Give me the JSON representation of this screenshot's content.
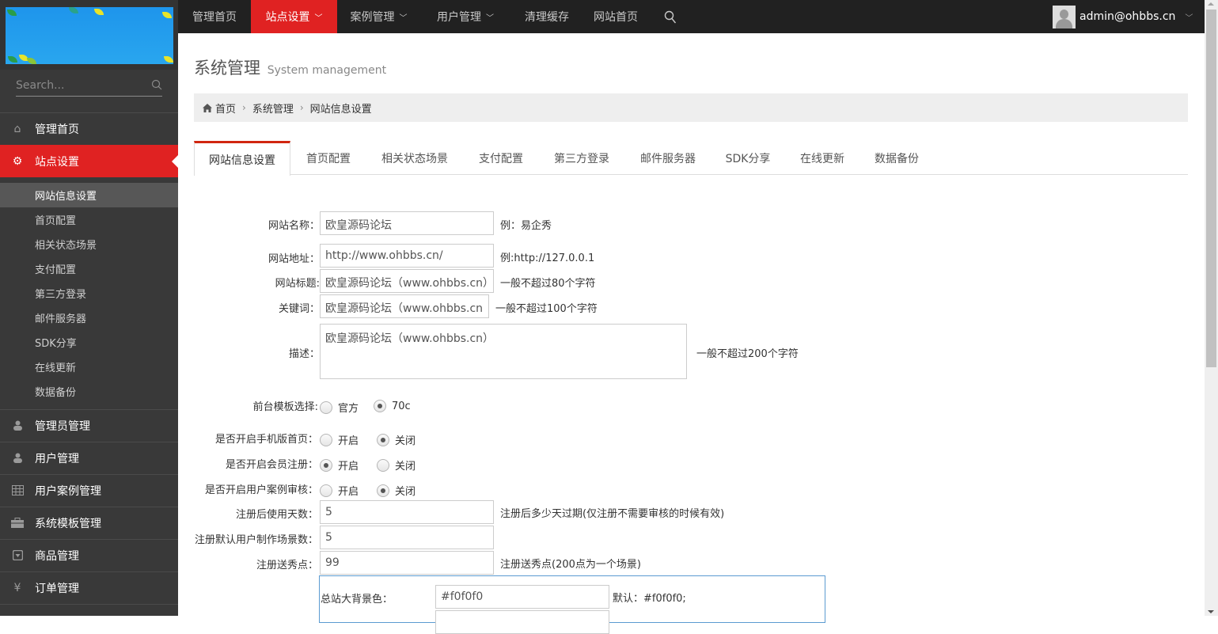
{
  "sidebar": {
    "search_placeholder": "Search...",
    "menu": [
      {
        "label": "管理首页",
        "icon": "home-icon",
        "glyph": "⌂"
      },
      {
        "label": "站点设置",
        "icon": "gears-icon",
        "glyph": "⚙",
        "active": true
      },
      {
        "label": "管理员管理",
        "icon": "user-icon",
        "glyph": "👤"
      },
      {
        "label": "用户管理",
        "icon": "user-icon",
        "glyph": "👤"
      },
      {
        "label": "用户案例管理",
        "icon": "table-icon",
        "glyph": "▦"
      },
      {
        "label": "系统模板管理",
        "icon": "briefcase-icon",
        "glyph": "▬"
      },
      {
        "label": "商品管理",
        "icon": "download-box-icon",
        "glyph": "▣"
      },
      {
        "label": "订单管理",
        "icon": "yen-icon",
        "glyph": "¥"
      }
    ],
    "submenu": [
      {
        "label": "网站信息设置",
        "active": true
      },
      {
        "label": "首页配置"
      },
      {
        "label": "相关状态场景"
      },
      {
        "label": "支付配置"
      },
      {
        "label": "第三方登录"
      },
      {
        "label": "邮件服务器"
      },
      {
        "label": "SDK分享"
      },
      {
        "label": "在线更新"
      },
      {
        "label": "数据备份"
      }
    ]
  },
  "topnav": {
    "items": [
      {
        "label": "管理首页"
      },
      {
        "label": "站点设置",
        "dropdown": true,
        "active": true
      },
      {
        "label": "案例管理",
        "dropdown": true
      },
      {
        "label": "用户管理",
        "dropdown": true
      },
      {
        "label": "清理缓存"
      },
      {
        "label": "网站首页"
      }
    ],
    "user": "admin@ohbbs.cn"
  },
  "page": {
    "title": "系统管理",
    "subtitle": "System management",
    "breadcrumb": [
      "首页",
      "系统管理",
      "网站信息设置"
    ]
  },
  "tabs": [
    "网站信息设置",
    "首页配置",
    "相关状态场景",
    "支付配置",
    "第三方登录",
    "邮件服务器",
    "SDK分享",
    "在线更新",
    "数据备份"
  ],
  "form": {
    "site_name": {
      "label": "网站名称：",
      "value": "欧皇源码论坛",
      "hint": "例：易企秀"
    },
    "site_url": {
      "label": "网站地址：",
      "value": "http://www.ohbbs.cn/",
      "hint": "例:http://127.0.0.1"
    },
    "site_title": {
      "label": "网站标题:",
      "value": "欧皇源码论坛（www.ohbbs.cn）",
      "hint": "一般不超过80个字符"
    },
    "keywords": {
      "label": "关键词：",
      "value": "欧皇源码论坛（www.ohbbs.cn",
      "hint": "一般不超过100个字符"
    },
    "description": {
      "label": "描述：",
      "value": "欧皇源码论坛（www.ohbbs.cn）",
      "hint": "一般不超过200个字符"
    },
    "template": {
      "label": "前台模板选择:",
      "options": [
        "官方",
        "70c"
      ],
      "selected": "70c"
    },
    "mobile_home": {
      "label": "是否开启手机版首页：",
      "options": [
        "开启",
        "关闭"
      ],
      "selected": "关闭"
    },
    "member_register": {
      "label": "是否开启会员注册：",
      "options": [
        "开启",
        "关闭"
      ],
      "selected": "开启"
    },
    "case_review": {
      "label": "是否开启用户案例审核：",
      "options": [
        "开启",
        "关闭"
      ],
      "selected": "关闭"
    },
    "trial_days": {
      "label": "注册后使用天数：",
      "value": "5",
      "hint": "注册后多少天过期(仅注册不需要审核的时候有效)"
    },
    "default_scenes": {
      "label": "注册默认用户制作场景数：",
      "value": "5"
    },
    "bonus_points": {
      "label": "注册送秀点：",
      "value": "99",
      "hint": "注册送秀点(200点为一个场景)"
    },
    "bg_color": {
      "label": "总站大背景色：",
      "value": "#f0f0f0",
      "hint": "默认：#f0f0f0;"
    }
  },
  "colors": {
    "accent": "#e02222",
    "topbar": "#212121",
    "sidebar": "#393939"
  }
}
